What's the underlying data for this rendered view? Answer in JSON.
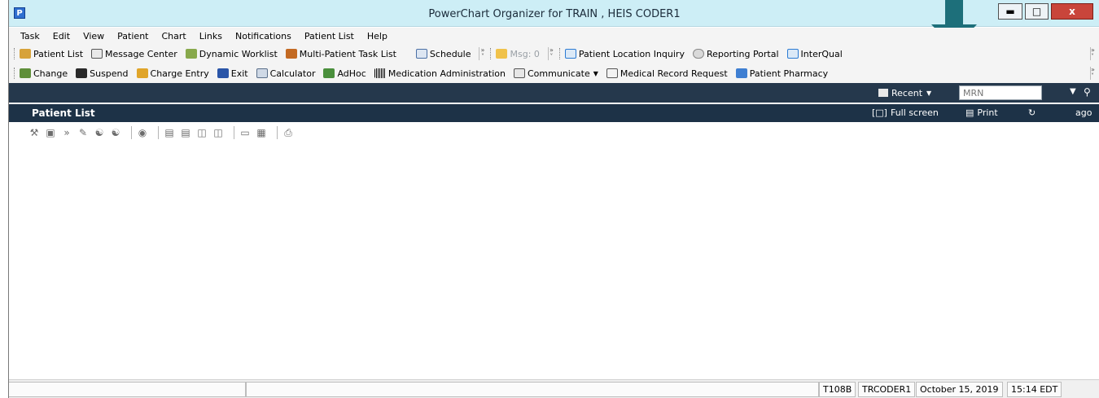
{
  "window": {
    "title": "PowerChart Organizer for TRAIN , HEIS CODER1",
    "app_icon_letter": "P"
  },
  "menubar": {
    "items": [
      "Task",
      "Edit",
      "View",
      "Patient",
      "Chart",
      "Links",
      "Notifications",
      "Patient List",
      "Help"
    ]
  },
  "toolbar1": {
    "patient_list": "Patient List",
    "message_center": "Message Center",
    "dynamic_worklist": "Dynamic Worklist",
    "multi_patient_task_list": "Multi-Patient Task List",
    "schedule": "Schedule",
    "msg": "Msg: 0",
    "patient_location_inquiry": "Patient Location Inquiry",
    "reporting_portal": "Reporting Portal",
    "interqual": "InterQual"
  },
  "toolbar2": {
    "change": "Change",
    "suspend": "Suspend",
    "charge_entry": "Charge Entry",
    "exit": "Exit",
    "calculator": "Calculator",
    "adhoc": "AdHoc",
    "medication_administration": "Medication Administration",
    "communicate": "Communicate",
    "medical_record_request": "Medical Record Request",
    "patient_pharmacy": "Patient Pharmacy"
  },
  "search": {
    "recent_label": "Recent",
    "mrn_placeholder": "MRN"
  },
  "panel": {
    "title": "Patient List",
    "full_screen": "Full screen",
    "print": "Print",
    "ago": "ago"
  },
  "status": {
    "terminal": "T108B",
    "user": "TRCODER1",
    "date": "October 15, 2019",
    "time": "15:14 EDT"
  },
  "colors": {
    "titlebar": "#cdeef6",
    "search_bar": "#25384c",
    "panel_bar": "#1d3247",
    "arrow": "#1d6f7a",
    "close_button": "#c9453b"
  }
}
